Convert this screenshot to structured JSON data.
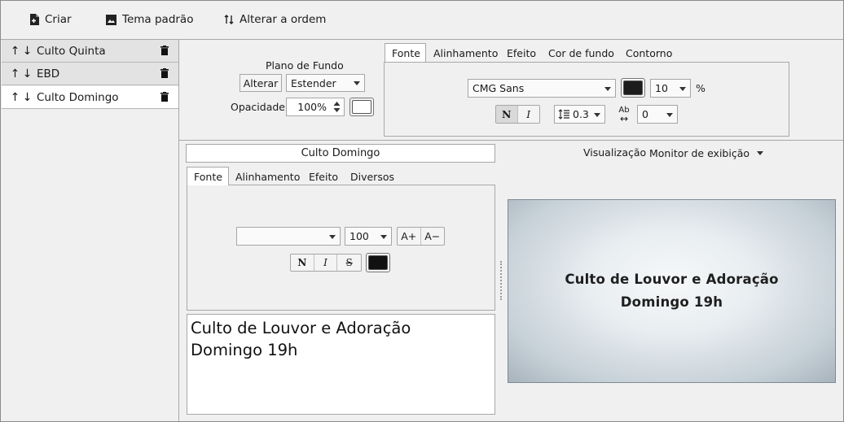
{
  "toolbar": {
    "create_label": "Criar",
    "default_theme_label": "Tema padrão",
    "reorder_label": "Alterar a ordem"
  },
  "sidebar": {
    "items": [
      {
        "label": "Culto Quinta",
        "up": "↑",
        "down": "↓"
      },
      {
        "label": "EBD",
        "up": "↑",
        "down": "↓"
      },
      {
        "label": "Culto Domingo",
        "up": "↑",
        "down": "↓",
        "selected": true
      }
    ]
  },
  "background": {
    "title": "Plano de Fundo",
    "change_label": "Alterar",
    "mode_value": "Estender",
    "opacity_label": "Opacidade",
    "opacity_value": "100%",
    "color": "#ffffff"
  },
  "theme_tabs": [
    "Fonte",
    "Alinhamento",
    "Efeito",
    "Cor de fundo",
    "Contorno"
  ],
  "theme_font": {
    "family": "CMG Sans",
    "color": "#1c1c1c",
    "size": "10",
    "size_unit": "%",
    "bold_label": "N",
    "italic_label": "I",
    "line_spacing": "0.3",
    "letter_spacing_icon": "letter-spacing-icon",
    "letter_spacing_top": "Ab",
    "letter_spacing_bottom": "↔",
    "letter_spacing": "0"
  },
  "slide": {
    "title": "Culto Domingo",
    "tabs": [
      "Fonte",
      "Alinhamento",
      "Efeito",
      "Diversos"
    ],
    "font_family": "",
    "font_size": "100",
    "increase_label": "A+",
    "decrease_label": "A−",
    "bold_label": "N",
    "italic_label": "I",
    "strike_label": "S",
    "color": "#111111",
    "text_lines": [
      "Culto de Louvor e Adoração",
      "Domingo 19h"
    ]
  },
  "preview": {
    "label": "Visualização",
    "monitor_value": "Monitor de exibição",
    "lines": [
      "Culto de Louvor e Adoração",
      "Domingo 19h"
    ]
  },
  "colors": {
    "selected_item_bg": "#ffffff",
    "item_bg": "#e3e3e3",
    "window_bg": "#f0f0f0"
  }
}
